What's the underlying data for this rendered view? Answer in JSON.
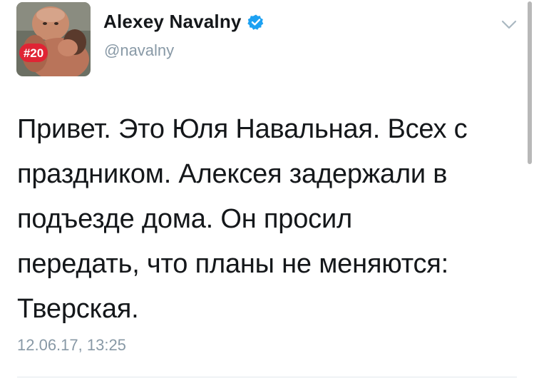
{
  "tweet": {
    "author": {
      "display_name": "Alexey Navalny",
      "handle": "@navalny",
      "verified": true,
      "avatar_badge": "#20",
      "verified_color": "#1da1f2"
    },
    "text_lines": [
      "Привет. Это Юля Навальная. Всех с",
      "праздником. Алексея задержали в",
      "подъезде дома. Он просил",
      "передать, что планы не меняются:",
      "Тверская."
    ],
    "timestamp": "12.06.17, 13:25",
    "icons": {
      "verified": "verified-badge-icon",
      "caret": "chevron-down-icon"
    }
  }
}
